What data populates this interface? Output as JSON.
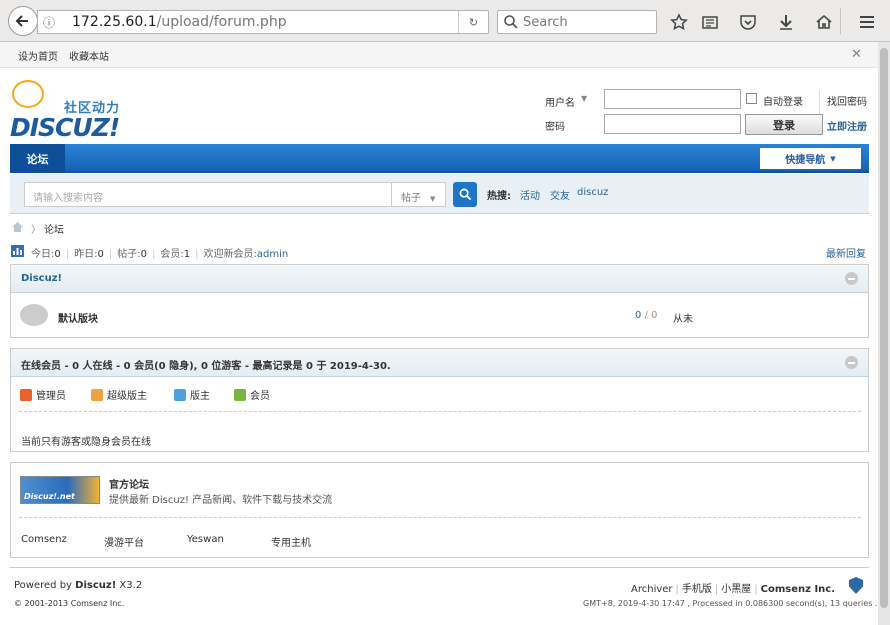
{
  "browser": {
    "url_host": "172.25.60.1",
    "url_path": "/upload/forum.php",
    "search_placeholder": "Search"
  },
  "topbar": {
    "set_home": "设为首页",
    "bookmark": "收藏本站"
  },
  "logo": {
    "subtitle": "社区动力",
    "name": "DISCUZ!"
  },
  "login": {
    "username_label": "用户名",
    "password_label": "密码",
    "remember_label": "自动登录",
    "forgot_link": "找回密码",
    "register_link": "立即注册",
    "login_button": "登录"
  },
  "nav": {
    "active_tab": "论坛",
    "quick_nav": "快捷导航"
  },
  "search": {
    "placeholder": "请输入搜索内容",
    "type": "帖子",
    "hot_label": "热搜:",
    "hot_items": [
      "活动",
      "交友",
      "discuz"
    ]
  },
  "breadcrumb": {
    "current": "论坛"
  },
  "stats": {
    "today_label": "今日:",
    "today": "0",
    "yesterday_label": "昨日:",
    "yesterday": "0",
    "posts_label": "帖子:",
    "posts": "0",
    "members_label": "会员:",
    "members": "1",
    "welcome_label": "欢迎新会员:",
    "newest": "admin",
    "latest_replies": "最新回复"
  },
  "category": {
    "title": "Discuz!",
    "forum": {
      "name": "默认版块",
      "threads": "0",
      "posts": "0",
      "last": "从未"
    }
  },
  "online": {
    "title": "在线会员 - 0 人在线 - 0 会员(0 隐身), 0 位游客 - 最高记录是 0 于 2019-4-30.",
    "legend": [
      {
        "label": "管理员",
        "color": "#e8622a"
      },
      {
        "label": "超级版主",
        "color": "#f2a23b"
      },
      {
        "label": "版主",
        "color": "#4aa3df"
      },
      {
        "label": "会员",
        "color": "#7bb33b"
      }
    ],
    "note": "当前只有游客或隐身会员在线"
  },
  "links": {
    "logo_text": "Discuz!.net",
    "title": "官方论坛",
    "desc": "提供最新 Discuz! 产品新闻、软件下载与技术交流",
    "friends": [
      "Comsenz",
      "漫游平台",
      "Yeswan",
      "专用主机"
    ]
  },
  "footer": {
    "powered_prefix": "Powered by ",
    "powered_name": "Discuz!",
    "version": " X3.2",
    "copyright": "© 2001-2013 Comsenz Inc.",
    "links": [
      "Archiver",
      "手机版",
      "小黑屋"
    ],
    "company": "Comsenz Inc.",
    "gmt": "GMT+8, 2019-4-30 17:47 , Processed in 0.086300 second(s), 13 queries ."
  }
}
